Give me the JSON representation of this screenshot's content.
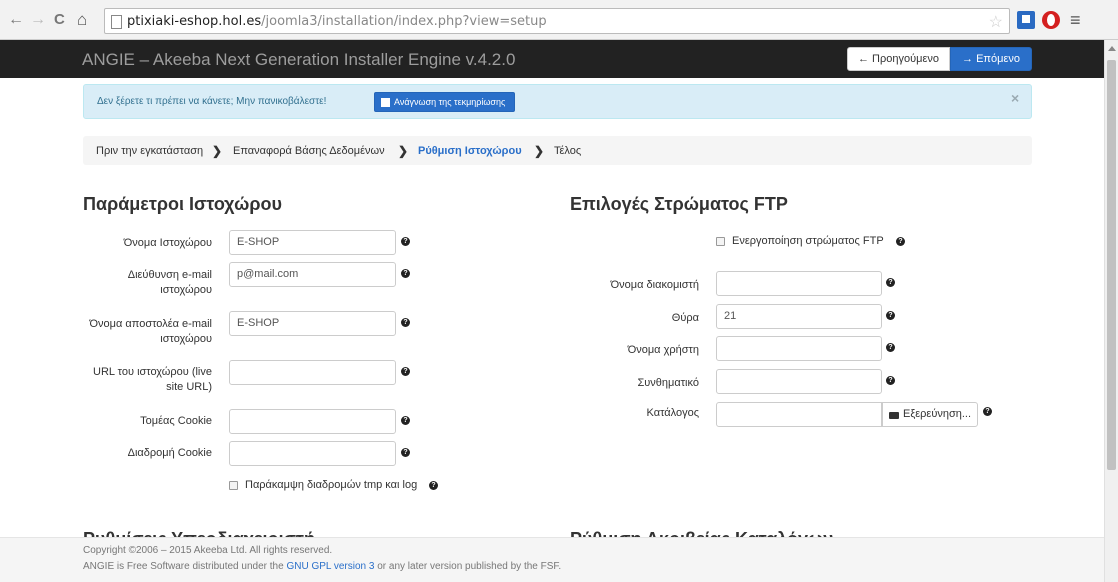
{
  "browser": {
    "back_icon": "←",
    "forward_icon": "→",
    "reload_icon": "C",
    "home_icon": "⌂",
    "url_host": "ptixiaki-eshop.hol.es",
    "url_path": "/joomla3/installation/index.php?view=setup",
    "star_icon": "☆",
    "menu_icon": "≡"
  },
  "header": {
    "title": "ANGIE – Akeeba Next Generation Installer Engine v.4.2.0",
    "prev_label": "← Προηγούμενο",
    "next_label": "→ Επόμενο"
  },
  "alert": {
    "text": "Δεν ξέρετε τι πρέπει να κάνετε; Μην πανικοβάλεστε!",
    "button_label": "Ανάγνωση της τεκμηρίωσης",
    "close": "×"
  },
  "breadcrumb": {
    "items": [
      "Πριν την εγκατάσταση",
      "Επαναφορά Βάσης Δεδομένων",
      "Ρύθμιση Ιστοχώρου",
      "Τέλος"
    ],
    "separator": "❯"
  },
  "site": {
    "heading": "Παράμετροι Ιστοχώρου",
    "fields": [
      {
        "label": "Όνομα Ιστοχώρου",
        "value": "E-SHOP"
      },
      {
        "label": "Διεύθυνση e-mail ιστοχώρου",
        "value": "p@mail.com"
      },
      {
        "label": "Όνομα αποστολέα e-mail ιστοχώρου",
        "value": "E-SHOP"
      },
      {
        "label": "URL του ιστοχώρου (live site URL)",
        "value": ""
      },
      {
        "label": "Τομέας Cookie",
        "value": ""
      },
      {
        "label": "Διαδρομή Cookie",
        "value": ""
      }
    ],
    "bypass_label": "Παράκαμψη διαδρομών tmp και log"
  },
  "ftp": {
    "heading": "Επιλογές Στρώματος FTP",
    "enable_label": "Ενεργοποίηση στρώματος FTP",
    "fields": [
      {
        "label": "Όνομα διακομιστή",
        "value": ""
      },
      {
        "label": "Θύρα",
        "value": "21"
      },
      {
        "label": "Όνομα χρήστη",
        "value": ""
      },
      {
        "label": "Συνθηματικό",
        "value": ""
      },
      {
        "label": "Κατάλογος",
        "value": ""
      }
    ],
    "browse_label": "Εξερεύνηση..."
  },
  "sections_below": {
    "left_heading": "Ρυθμίσεις Υπερδιαχειριστή",
    "right_heading": "Ρύθμιση Ακριβείας Καταλόγων"
  },
  "footer": {
    "copyright": "Copyright ©2006 – 2015 Akeeba Ltd. All rights reserved.",
    "license_prefix": "ANGIE is Free Software distributed under the ",
    "license_link": "GNU GPL version 3",
    "license_suffix": " or any later version published by the FSF."
  },
  "help_glyph": "?",
  "colors": {
    "primary": "#2a6fc9",
    "navbar": "#222222",
    "alert_bg": "#d9edf7"
  }
}
